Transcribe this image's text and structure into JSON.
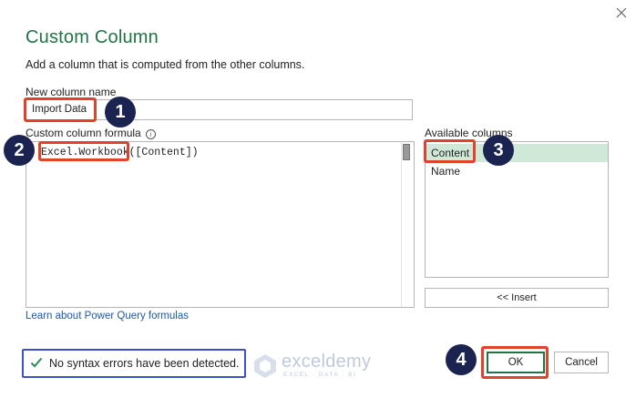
{
  "dialog": {
    "title": "Custom Column",
    "subtitle": "Add a column that is computed from the other columns.",
    "close_icon": "close-icon"
  },
  "new_column": {
    "label": "New column name",
    "value": "Import Data"
  },
  "formula": {
    "label": "Custom column formula",
    "info_icon": "info-icon",
    "info_glyph": "i",
    "function_text": "Excel.Workbook",
    "arg_text": "([Content])"
  },
  "available_columns": {
    "label": "Available columns",
    "items": [
      "Content",
      "Name"
    ],
    "selected_index": 0,
    "insert_label": "<< Insert"
  },
  "learn_link": "Learn about Power Query formulas",
  "status": {
    "icon": "check-icon",
    "text": "No syntax errors have been detected."
  },
  "buttons": {
    "ok": "OK",
    "cancel": "Cancel"
  },
  "annotations": {
    "badges": [
      "1",
      "2",
      "3",
      "4"
    ],
    "highlight_color": "#e0432a",
    "badge_color": "#1b2451",
    "status_box_color": "#3d52c9"
  },
  "watermark": {
    "name": "exceldemy",
    "tagline": "EXCEL · DATA · BI"
  },
  "colors": {
    "title": "#217346",
    "link": "#1e5aa8",
    "selected_row": "#cfe8d8",
    "check": "#2e8b57"
  }
}
